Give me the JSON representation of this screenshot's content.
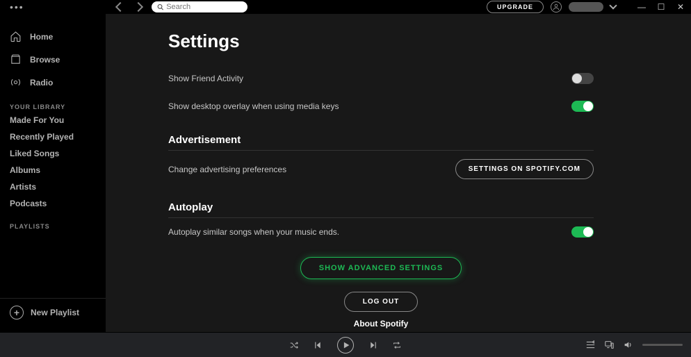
{
  "topbar": {
    "search_placeholder": "Search",
    "upgrade_label": "UPGRADE"
  },
  "sidebar": {
    "nav": [
      {
        "label": "Home"
      },
      {
        "label": "Browse"
      },
      {
        "label": "Radio"
      }
    ],
    "library_header": "YOUR LIBRARY",
    "library": [
      {
        "label": "Made For You"
      },
      {
        "label": "Recently Played"
      },
      {
        "label": "Liked Songs"
      },
      {
        "label": "Albums"
      },
      {
        "label": "Artists"
      },
      {
        "label": "Podcasts"
      }
    ],
    "playlists_header": "PLAYLISTS",
    "new_playlist_label": "New Playlist"
  },
  "settings": {
    "title": "Settings",
    "friend_activity_label": "Show Friend Activity",
    "friend_activity_on": false,
    "overlay_label": "Show desktop overlay when using media keys",
    "overlay_on": true,
    "ad_section": "Advertisement",
    "ad_label": "Change advertising preferences",
    "ad_button": "SETTINGS ON SPOTIFY.COM",
    "autoplay_section": "Autoplay",
    "autoplay_label": "Autoplay similar songs when your music ends.",
    "autoplay_on": true,
    "advanced_button": "SHOW ADVANCED SETTINGS",
    "logout_button": "LOG OUT",
    "about_label": "About Spotify"
  }
}
